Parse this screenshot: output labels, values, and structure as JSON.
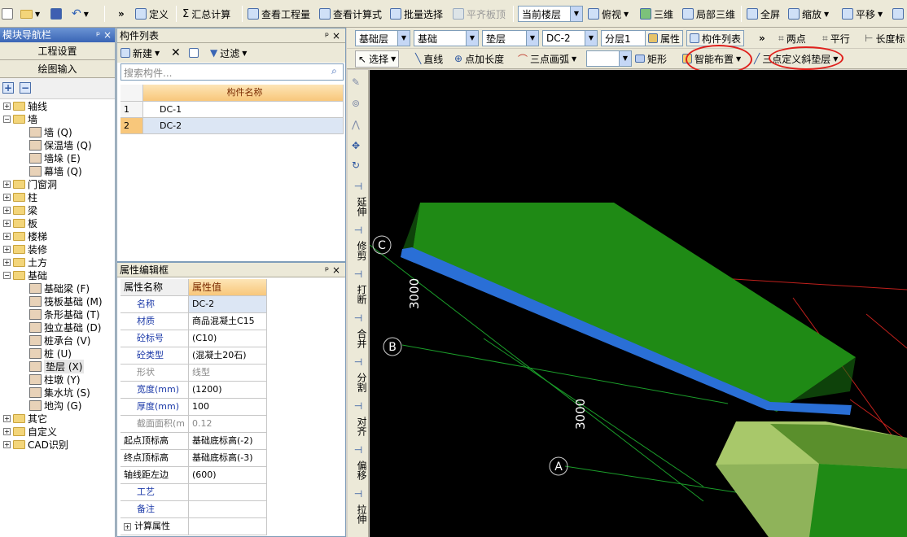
{
  "top_toolbar": {
    "items": [
      "定义",
      "汇总计算",
      "查看工程量",
      "查看计算式",
      "批量选择",
      "平齐板顶"
    ],
    "floor_combo": "当前楼层",
    "view_items": [
      "俯视",
      "三维",
      "局部三维",
      "全屏",
      "缩放",
      "平移"
    ]
  },
  "nav": {
    "title": "模块导航栏",
    "pin": "ᵖ ×",
    "section_project": "工程设置",
    "section_draw": "绘图输入",
    "tree": [
      {
        "label": "轴线",
        "level": 0,
        "expand": "+"
      },
      {
        "label": "墙",
        "level": 0,
        "expand": "−"
      },
      {
        "label": "墙 (Q)",
        "level": 1
      },
      {
        "label": "保温墙 (Q)",
        "level": 1
      },
      {
        "label": "墙垛 (E)",
        "level": 1
      },
      {
        "label": "幕墙 (Q)",
        "level": 1
      },
      {
        "label": "门窗洞",
        "level": 0,
        "expand": "+"
      },
      {
        "label": "柱",
        "level": 0,
        "expand": "+"
      },
      {
        "label": "梁",
        "level": 0,
        "expand": "+"
      },
      {
        "label": "板",
        "level": 0,
        "expand": "+"
      },
      {
        "label": "楼梯",
        "level": 0,
        "expand": "+"
      },
      {
        "label": "装修",
        "level": 0,
        "expand": "+"
      },
      {
        "label": "土方",
        "level": 0,
        "expand": "+"
      },
      {
        "label": "基础",
        "level": 0,
        "expand": "−"
      },
      {
        "label": "基础梁 (F)",
        "level": 1
      },
      {
        "label": "筏板基础 (M)",
        "level": 1
      },
      {
        "label": "条形基础 (T)",
        "level": 1
      },
      {
        "label": "独立基础 (D)",
        "level": 1
      },
      {
        "label": "桩承台 (V)",
        "level": 1
      },
      {
        "label": "桩 (U)",
        "level": 1
      },
      {
        "label": "垫层 (X)",
        "level": 1,
        "selected": true
      },
      {
        "label": "柱墩 (Y)",
        "level": 1
      },
      {
        "label": "集水坑 (S)",
        "level": 1
      },
      {
        "label": "地沟 (G)",
        "level": 1
      },
      {
        "label": "其它",
        "level": 0,
        "expand": "+"
      },
      {
        "label": "自定义",
        "level": 0,
        "expand": "+"
      },
      {
        "label": "CAD识别",
        "level": 0,
        "expand": "+"
      }
    ]
  },
  "component_list": {
    "title": "构件列表",
    "new_label": "新建",
    "filter_label": "过滤",
    "search_placeholder": "搜索构件...",
    "col_header": "构件名称",
    "rows": [
      {
        "idx": "1",
        "name": "DC-1"
      },
      {
        "idx": "2",
        "name": "DC-2"
      }
    ]
  },
  "properties": {
    "title": "属性编辑框",
    "col_name": "属性名称",
    "col_value": "属性值",
    "rows": [
      {
        "name": "名称",
        "value": "DC-2",
        "style": "blue"
      },
      {
        "name": "材质",
        "value": "商品混凝土C15",
        "style": "blue"
      },
      {
        "name": "砼标号",
        "value": "(C10)",
        "style": "blue"
      },
      {
        "name": "砼类型",
        "value": "(混凝土20石)",
        "style": "blue"
      },
      {
        "name": "形状",
        "value": "线型",
        "style": "gray"
      },
      {
        "name": "宽度(mm)",
        "value": "(1200)",
        "style": "blue"
      },
      {
        "name": "厚度(mm)",
        "value": "100",
        "style": "blue"
      },
      {
        "name": "截面面积(m",
        "value": "0.12",
        "style": "gray"
      },
      {
        "name": "起点顶标高",
        "value": "基础底标高(-2)",
        "style": "black"
      },
      {
        "name": "终点顶标高",
        "value": "基础底标高(-3)",
        "style": "black"
      },
      {
        "name": "轴线距左边",
        "value": "(600)",
        "style": "black"
      },
      {
        "name": "工艺",
        "value": "",
        "style": "blue"
      },
      {
        "name": "备注",
        "value": "",
        "style": "blue"
      },
      {
        "name": "计算属性",
        "value": "",
        "style": "black"
      }
    ]
  },
  "layer_bar": {
    "layer": "基础层",
    "category": "基础",
    "type": "垫层",
    "component": "DC-2",
    "sublayer": "分层1",
    "attr_btn": "属性",
    "list_btn": "构件列表",
    "two_point": "两点",
    "parallel": "平行",
    "length": "长度标"
  },
  "draw_bar": {
    "select": "选择",
    "line": "直线",
    "point_len": "点加长度",
    "arc": "三点画弧",
    "rect": "矩形",
    "smart": "智能布置",
    "slope": "三点定义斜垫层"
  },
  "side_tools": [
    "延伸",
    "修剪",
    "打断",
    "合并",
    "分割",
    "对齐",
    "偏移",
    "拉伸"
  ],
  "viewport": {
    "axis_c": "C",
    "axis_b": "B",
    "axis_a": "A",
    "dim1": "3000",
    "dim2": "3000"
  }
}
